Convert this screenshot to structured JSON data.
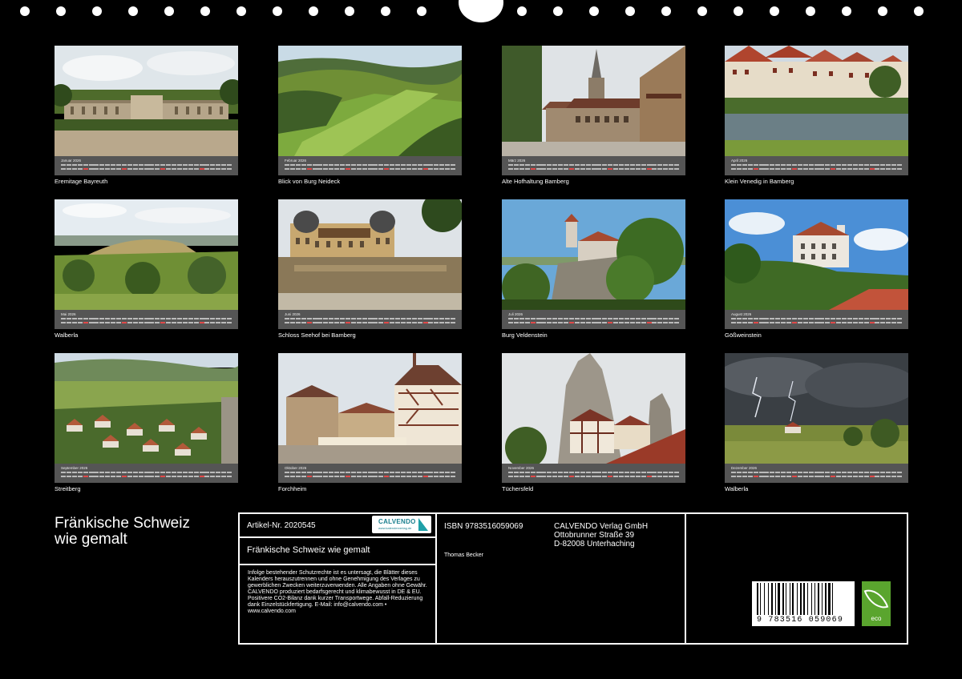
{
  "months": [
    {
      "month": "Januar 2026",
      "caption": "Eremitage Bayreuth",
      "scene": "palace-garden"
    },
    {
      "month": "Februar 2026",
      "caption": "Blick von Burg Neideck",
      "scene": "green-valley"
    },
    {
      "month": "März 2026",
      "caption": "Alte Hofhaltung Bamberg",
      "scene": "old-courtyard"
    },
    {
      "month": "April 2026",
      "caption": "Klein Venedig in Bamberg",
      "scene": "riverside-houses"
    },
    {
      "month": "Mai 2026",
      "caption": "Walberla",
      "scene": "hill-landscape"
    },
    {
      "month": "Juni 2026",
      "caption": "Schloss Seehof bei Bamberg",
      "scene": "baroque-castle"
    },
    {
      "month": "Juli 2026",
      "caption": "Burg Veldenstein",
      "scene": "castle-on-rock"
    },
    {
      "month": "August 2026",
      "caption": "Gößweinstein",
      "scene": "castle-blue-sky"
    },
    {
      "month": "September 2026",
      "caption": "Streitberg",
      "scene": "village-from-above"
    },
    {
      "month": "Oktober 2026",
      "caption": "Forchheim",
      "scene": "market-square"
    },
    {
      "month": "November 2026",
      "caption": "Tüchersfeld",
      "scene": "rock-village"
    },
    {
      "month": "Dezember 2026",
      "caption": "Walberla",
      "scene": "thunderstorm"
    }
  ],
  "title": {
    "line1": "Fränkische Schweiz",
    "line2": "wie gemalt"
  },
  "info": {
    "article": "Artikel-Nr. 2020545",
    "subtitle": "Fränkische Schweiz wie gemalt",
    "isbn": "ISBN 9783516059069",
    "author": "Thomas Becker",
    "publisher": [
      "CALVENDO Verlag GmbH",
      "Ottobrunner Straße 39",
      "D-82008 Unterhaching"
    ],
    "legal": "Infolge bestehender Schutzrechte ist es untersagt, die Blätter dieses Kalenders herauszutrennen und ohne Genehmigung des Verlages zu gewerblichen Zwecken weiterzuverwenden. Alle Angaben ohne Gewähr. CALVENDO produziert bedarfsgerecht und klimabewusst in DE & EU. Positivere CO2-Bilanz dank kurzer Transportwege. Abfall-Reduzierung dank Einzelstückfertigung. E-Mail: info@calvendo.com • www.calvendo.com",
    "logo_text": "CALVENDO",
    "logo_sub": "www.kalenderverlag.de",
    "barcode_number": "9 783516 059069",
    "eco_label": "eco"
  },
  "colors": {
    "background": "#000000",
    "calendar_strip": "#555555",
    "sunday": "#e04a4a",
    "eco_green": "#5aa52e",
    "calvendo_teal": "#1a7f8e"
  }
}
